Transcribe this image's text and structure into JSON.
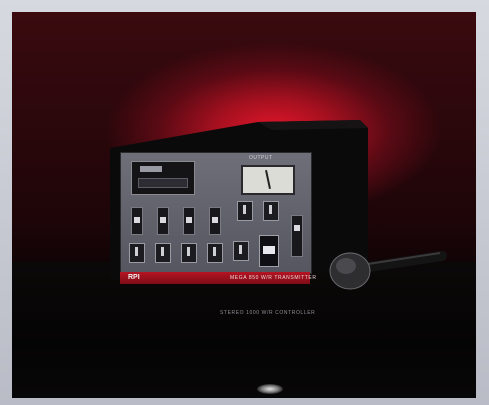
{
  "image": {
    "panel_top_label": "OUTPUT",
    "brand_mark": "RPI",
    "strip_text": "MEGA 850 W/R TRANSMITTER",
    "base_text": "STEREO 1000 W/R CONTROLLER",
    "colors": {
      "backdrop": "#e0162a",
      "device_body": "#0b0a0b",
      "panel": "#5e5f68",
      "strip": "#b41422",
      "frame": "#c9cbd2"
    }
  }
}
